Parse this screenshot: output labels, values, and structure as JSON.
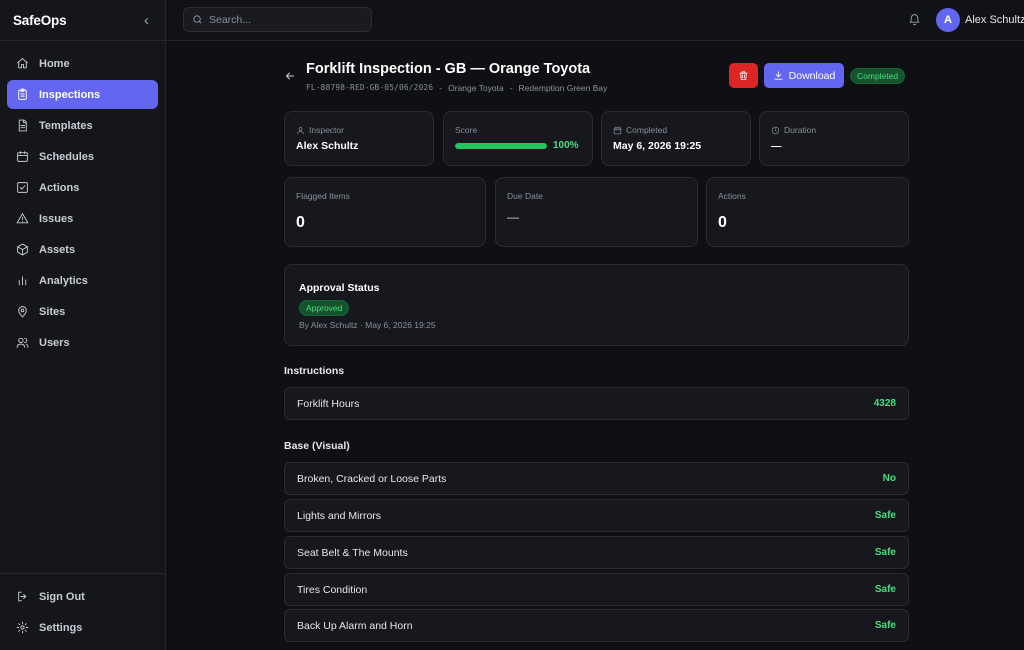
{
  "app": {
    "brand": "SafeOps"
  },
  "sidebar": {
    "items": [
      {
        "label": "Home",
        "icon": "home-icon",
        "active": false
      },
      {
        "label": "Inspections",
        "icon": "clipboard-icon",
        "active": true
      },
      {
        "label": "Templates",
        "icon": "document-icon",
        "active": false
      },
      {
        "label": "Schedules",
        "icon": "calendar-icon",
        "active": false
      },
      {
        "label": "Actions",
        "icon": "checkbox-icon",
        "active": false
      },
      {
        "label": "Issues",
        "icon": "warning-icon",
        "active": false
      },
      {
        "label": "Assets",
        "icon": "box-icon",
        "active": false
      },
      {
        "label": "Analytics",
        "icon": "bar-chart-icon",
        "active": false
      },
      {
        "label": "Sites",
        "icon": "map-pin-icon",
        "active": false
      },
      {
        "label": "Users",
        "icon": "users-icon",
        "active": false
      }
    ],
    "bottom": [
      {
        "label": "Sign Out",
        "icon": "sign-out-icon"
      },
      {
        "label": "Settings",
        "icon": "gear-icon"
      }
    ]
  },
  "topbar": {
    "search_placeholder": "Search...",
    "user": {
      "initial": "A",
      "name": "Alex Schultz"
    }
  },
  "header": {
    "title": "Forklift Inspection - GB — Orange Toyota",
    "code": "FL-88798-RED-GB-05/06/2026",
    "asset": "Orange Toyota",
    "site": "Redemption Green Bay",
    "separator": "-",
    "download_label": "Download",
    "status": "Completed"
  },
  "stats": {
    "inspector": {
      "label": "Inspector",
      "value": "Alex Schultz"
    },
    "score": {
      "label": "Score",
      "value": "100%",
      "fraction": 1.0
    },
    "completed": {
      "label": "Completed",
      "value": "May 6, 2026 19:25"
    },
    "duration": {
      "label": "Duration",
      "value": "—"
    }
  },
  "summary": {
    "flagged": {
      "label": "Flagged Items",
      "value": "0"
    },
    "due": {
      "label": "Due Date",
      "value": "—"
    },
    "actions": {
      "label": "Actions",
      "value": "0"
    }
  },
  "approval": {
    "title": "Approval Status",
    "status": "Approved",
    "by": "By Alex Schultz · May 6, 2026 19:25"
  },
  "sections": [
    {
      "title": "Instructions",
      "rows": [
        {
          "label": "Forklift Hours",
          "value": "4328"
        }
      ]
    },
    {
      "title": "Base (Visual)",
      "rows": [
        {
          "label": "Broken, Cracked or Loose Parts",
          "value": "No"
        },
        {
          "label": "Lights and Mirrors",
          "value": "Safe"
        },
        {
          "label": "Seat Belt & The Mounts",
          "value": "Safe"
        },
        {
          "label": "Tires Condition",
          "value": "Safe"
        },
        {
          "label": "Back Up Alarm and Horn",
          "value": "Safe"
        }
      ]
    }
  ],
  "colors": {
    "accent": "#6366f1",
    "danger": "#dc2626",
    "success": "#4ade80",
    "background": "#0f1014",
    "card": "#17181d"
  }
}
